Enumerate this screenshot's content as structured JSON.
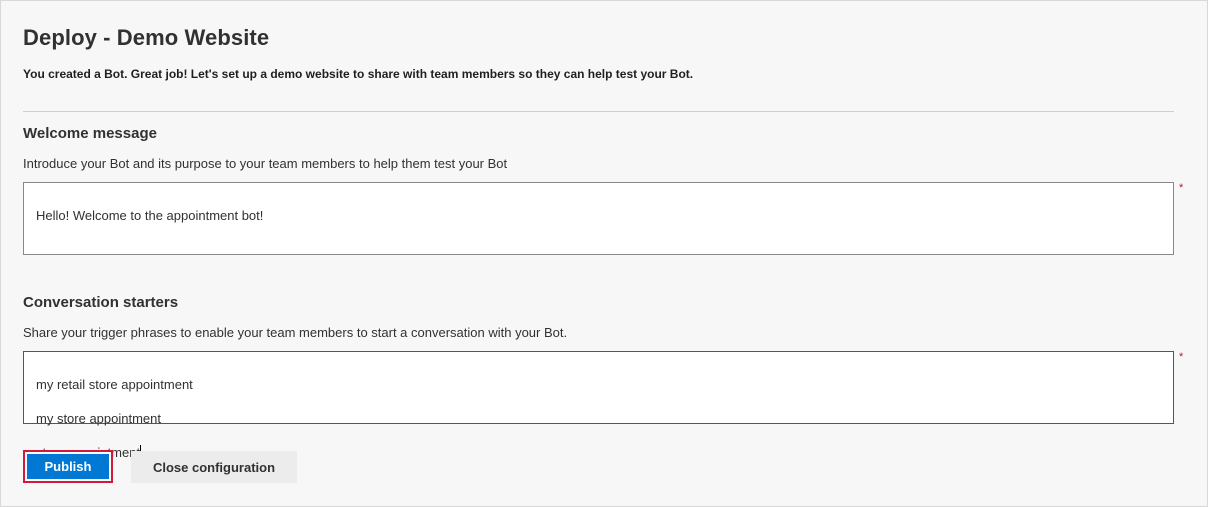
{
  "page": {
    "title": "Deploy - Demo Website",
    "subtitle": "You created a Bot. Great job! Let's set up a demo website to share with team members so they can help test your Bot."
  },
  "welcome": {
    "heading": "Welcome message",
    "description": "Introduce your Bot and its purpose to your team members to help them test your Bot",
    "value": "Hello! Welcome to the appointment bot!",
    "required_mark": "*"
  },
  "starters": {
    "heading": "Conversation starters",
    "description": "Share your trigger phrases to enable your team members to start a conversation with your Bot.",
    "lines": [
      "my retail store appointment",
      "my store appointment",
      "store appointment"
    ],
    "required_mark": "*"
  },
  "actions": {
    "publish_label": "Publish",
    "close_label": "Close configuration"
  },
  "colors": {
    "primary": "#0078d4",
    "highlight": "#d4183a",
    "required": "#a4262c"
  }
}
